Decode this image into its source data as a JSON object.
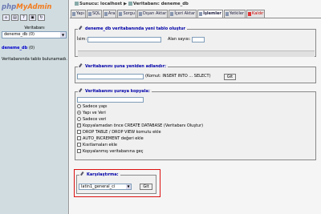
{
  "app": {
    "logo_a": "php",
    "logo_b": "MyAdmin"
  },
  "left": {
    "db_label": "Veritabanı",
    "db_select": "deneme_db (0)",
    "db_link": "deneme_db",
    "db_count": "(0)",
    "no_tables": "Veritabanında tablo bulunamadı."
  },
  "breadcrumb": {
    "server": "Sunucu: localhost",
    "sep": "▶",
    "database": "Veritabanı: deneme_db"
  },
  "tabs": [
    {
      "label": "Yapı"
    },
    {
      "label": "SQL"
    },
    {
      "label": "Ara"
    },
    {
      "label": "Sorgu"
    },
    {
      "label": "Dışarı Aktar"
    },
    {
      "label": "İçeri Aktar"
    },
    {
      "label": "İşlemler"
    },
    {
      "label": "Yetkiler"
    },
    {
      "label": "Kaldır"
    }
  ],
  "create": {
    "legend": "deneme_db veritabanında yeni tablo oluştur",
    "name_label": "İsim:",
    "fields_label": "Alan sayısı:"
  },
  "rename": {
    "legend": "Veritabanını şuna yeniden adlandır:",
    "hint": "(Komut: INSERT INTO ... SELECT)",
    "go": "Git"
  },
  "copy": {
    "legend": "Veritabanını şuraya kopyala:",
    "options": [
      {
        "label": "Sadece yapı",
        "kind": "radio",
        "checked": false
      },
      {
        "label": "Yapı ve Veri",
        "kind": "radio",
        "checked": true
      },
      {
        "label": "Sadece veri",
        "kind": "radio",
        "checked": false
      },
      {
        "label": "Kopyalamadan önce CREATE DATABASE (Veritabanı Oluştur)",
        "kind": "check",
        "checked": true
      },
      {
        "label": "DROP TABLE / DROP VIEW komutu ekle",
        "kind": "check",
        "checked": false
      },
      {
        "label": "AUTO_INCREMENT değeri ekle",
        "kind": "check",
        "checked": false
      },
      {
        "label": "Kısıtlamaları ekle",
        "kind": "check",
        "checked": false
      },
      {
        "label": "Kopyalanmış veritabanına geç",
        "kind": "check",
        "checked": false
      }
    ]
  },
  "collation": {
    "legend": "Karşılaştırma:",
    "value": "latin1_general_ci",
    "go": "Git"
  }
}
